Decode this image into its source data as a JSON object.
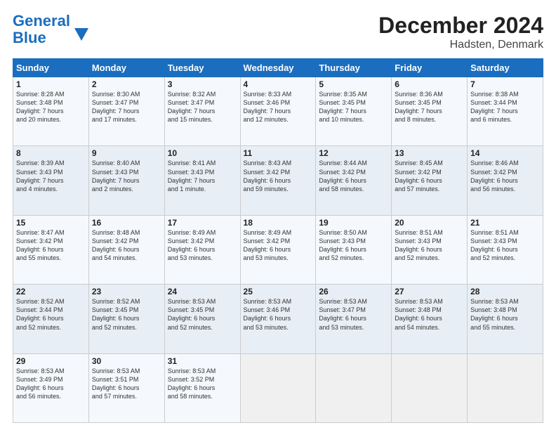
{
  "logo": {
    "line1": "General",
    "line2": "Blue"
  },
  "title": "December 2024",
  "subtitle": "Hadsten, Denmark",
  "weekdays": [
    "Sunday",
    "Monday",
    "Tuesday",
    "Wednesday",
    "Thursday",
    "Friday",
    "Saturday"
  ],
  "weeks": [
    [
      {
        "day": "1",
        "info": "Sunrise: 8:28 AM\nSunset: 3:48 PM\nDaylight: 7 hours\nand 20 minutes."
      },
      {
        "day": "2",
        "info": "Sunrise: 8:30 AM\nSunset: 3:47 PM\nDaylight: 7 hours\nand 17 minutes."
      },
      {
        "day": "3",
        "info": "Sunrise: 8:32 AM\nSunset: 3:47 PM\nDaylight: 7 hours\nand 15 minutes."
      },
      {
        "day": "4",
        "info": "Sunrise: 8:33 AM\nSunset: 3:46 PM\nDaylight: 7 hours\nand 12 minutes."
      },
      {
        "day": "5",
        "info": "Sunrise: 8:35 AM\nSunset: 3:45 PM\nDaylight: 7 hours\nand 10 minutes."
      },
      {
        "day": "6",
        "info": "Sunrise: 8:36 AM\nSunset: 3:45 PM\nDaylight: 7 hours\nand 8 minutes."
      },
      {
        "day": "7",
        "info": "Sunrise: 8:38 AM\nSunset: 3:44 PM\nDaylight: 7 hours\nand 6 minutes."
      }
    ],
    [
      {
        "day": "8",
        "info": "Sunrise: 8:39 AM\nSunset: 3:43 PM\nDaylight: 7 hours\nand 4 minutes."
      },
      {
        "day": "9",
        "info": "Sunrise: 8:40 AM\nSunset: 3:43 PM\nDaylight: 7 hours\nand 2 minutes."
      },
      {
        "day": "10",
        "info": "Sunrise: 8:41 AM\nSunset: 3:43 PM\nDaylight: 7 hours\nand 1 minute."
      },
      {
        "day": "11",
        "info": "Sunrise: 8:43 AM\nSunset: 3:42 PM\nDaylight: 6 hours\nand 59 minutes."
      },
      {
        "day": "12",
        "info": "Sunrise: 8:44 AM\nSunset: 3:42 PM\nDaylight: 6 hours\nand 58 minutes."
      },
      {
        "day": "13",
        "info": "Sunrise: 8:45 AM\nSunset: 3:42 PM\nDaylight: 6 hours\nand 57 minutes."
      },
      {
        "day": "14",
        "info": "Sunrise: 8:46 AM\nSunset: 3:42 PM\nDaylight: 6 hours\nand 56 minutes."
      }
    ],
    [
      {
        "day": "15",
        "info": "Sunrise: 8:47 AM\nSunset: 3:42 PM\nDaylight: 6 hours\nand 55 minutes."
      },
      {
        "day": "16",
        "info": "Sunrise: 8:48 AM\nSunset: 3:42 PM\nDaylight: 6 hours\nand 54 minutes."
      },
      {
        "day": "17",
        "info": "Sunrise: 8:49 AM\nSunset: 3:42 PM\nDaylight: 6 hours\nand 53 minutes."
      },
      {
        "day": "18",
        "info": "Sunrise: 8:49 AM\nSunset: 3:42 PM\nDaylight: 6 hours\nand 53 minutes."
      },
      {
        "day": "19",
        "info": "Sunrise: 8:50 AM\nSunset: 3:43 PM\nDaylight: 6 hours\nand 52 minutes."
      },
      {
        "day": "20",
        "info": "Sunrise: 8:51 AM\nSunset: 3:43 PM\nDaylight: 6 hours\nand 52 minutes."
      },
      {
        "day": "21",
        "info": "Sunrise: 8:51 AM\nSunset: 3:43 PM\nDaylight: 6 hours\nand 52 minutes."
      }
    ],
    [
      {
        "day": "22",
        "info": "Sunrise: 8:52 AM\nSunset: 3:44 PM\nDaylight: 6 hours\nand 52 minutes."
      },
      {
        "day": "23",
        "info": "Sunrise: 8:52 AM\nSunset: 3:45 PM\nDaylight: 6 hours\nand 52 minutes."
      },
      {
        "day": "24",
        "info": "Sunrise: 8:53 AM\nSunset: 3:45 PM\nDaylight: 6 hours\nand 52 minutes."
      },
      {
        "day": "25",
        "info": "Sunrise: 8:53 AM\nSunset: 3:46 PM\nDaylight: 6 hours\nand 53 minutes."
      },
      {
        "day": "26",
        "info": "Sunrise: 8:53 AM\nSunset: 3:47 PM\nDaylight: 6 hours\nand 53 minutes."
      },
      {
        "day": "27",
        "info": "Sunrise: 8:53 AM\nSunset: 3:48 PM\nDaylight: 6 hours\nand 54 minutes."
      },
      {
        "day": "28",
        "info": "Sunrise: 8:53 AM\nSunset: 3:48 PM\nDaylight: 6 hours\nand 55 minutes."
      }
    ],
    [
      {
        "day": "29",
        "info": "Sunrise: 8:53 AM\nSunset: 3:49 PM\nDaylight: 6 hours\nand 56 minutes."
      },
      {
        "day": "30",
        "info": "Sunrise: 8:53 AM\nSunset: 3:51 PM\nDaylight: 6 hours\nand 57 minutes."
      },
      {
        "day": "31",
        "info": "Sunrise: 8:53 AM\nSunset: 3:52 PM\nDaylight: 6 hours\nand 58 minutes."
      },
      {
        "day": "",
        "info": ""
      },
      {
        "day": "",
        "info": ""
      },
      {
        "day": "",
        "info": ""
      },
      {
        "day": "",
        "info": ""
      }
    ]
  ]
}
